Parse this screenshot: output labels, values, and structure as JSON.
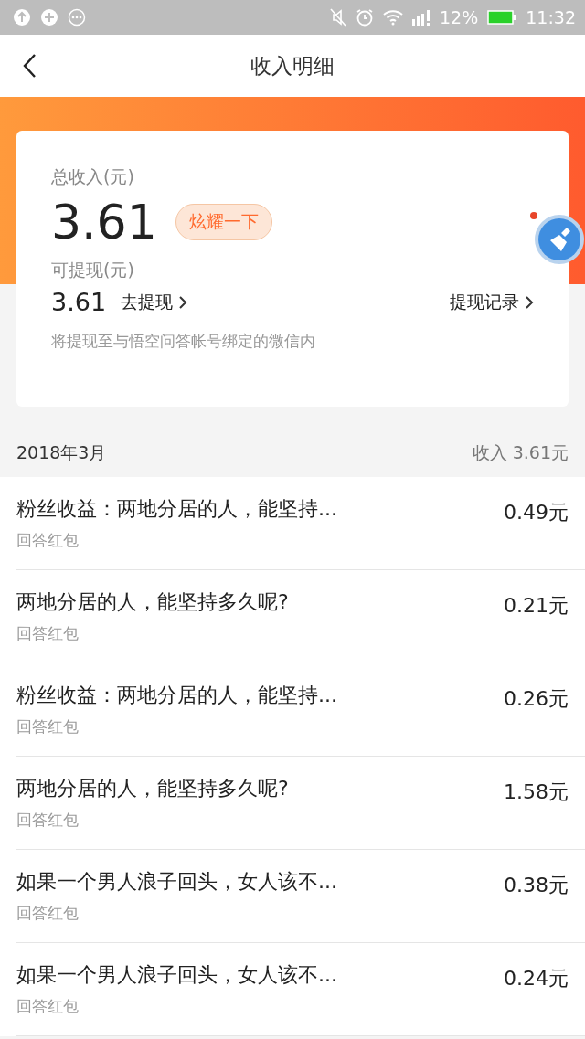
{
  "status_bar": {
    "battery": "12%",
    "time": "11:32"
  },
  "header": {
    "title": "收入明细"
  },
  "summary": {
    "total_label": "总收入(元)",
    "total": "3.61",
    "share_button": "炫耀一下",
    "withdrawable_label": "可提现(元)",
    "withdrawable": "3.61",
    "withdraw_link": "去提现",
    "history_link": "提现记录",
    "note": "将提现至与悟空问答帐号绑定的微信内"
  },
  "month": {
    "label": "2018年3月",
    "income": "收入 3.61元"
  },
  "rows": [
    {
      "title": "粉丝收益：两地分居的人，能坚持...",
      "subtitle": "回答红包",
      "amount": "0.49元"
    },
    {
      "title": "两地分居的人，能坚持多久呢?",
      "subtitle": "回答红包",
      "amount": "0.21元"
    },
    {
      "title": "粉丝收益：两地分居的人，能坚持...",
      "subtitle": "回答红包",
      "amount": "0.26元"
    },
    {
      "title": "两地分居的人，能坚持多久呢?",
      "subtitle": "回答红包",
      "amount": "1.58元"
    },
    {
      "title": "如果一个男人浪子回头，女人该不...",
      "subtitle": "回答红包",
      "amount": "0.38元"
    },
    {
      "title": "如果一个男人浪子回头，女人该不...",
      "subtitle": "回答红包",
      "amount": "0.24元"
    }
  ]
}
